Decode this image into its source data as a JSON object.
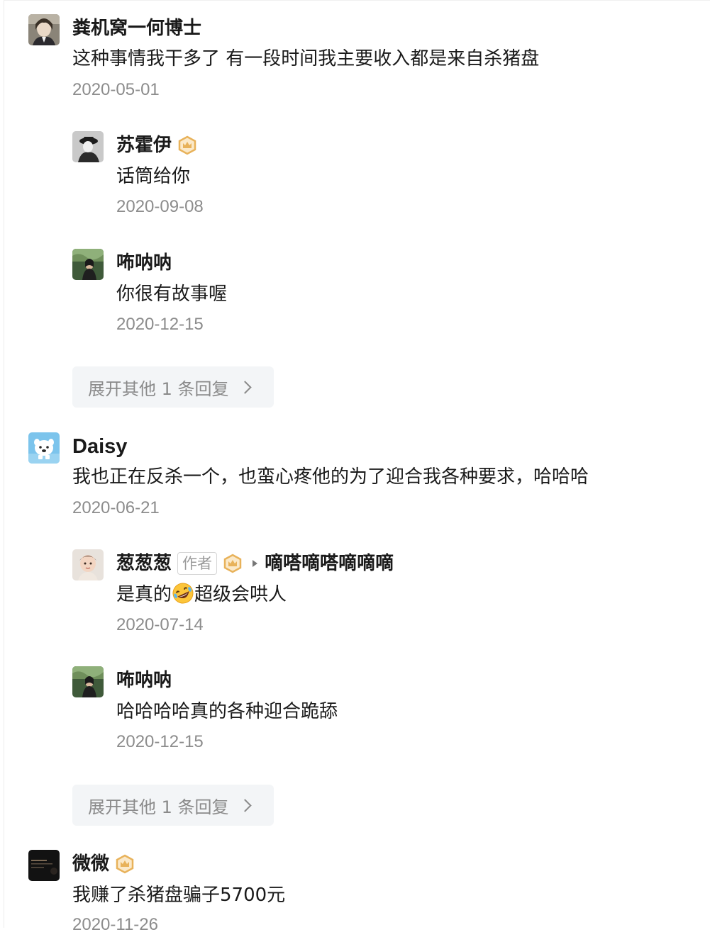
{
  "comments": [
    {
      "user": "粪机窝一何博士",
      "text": "这种事情我干多了 有一段时间我主要收入都是来自杀猪盘",
      "date": "2020-05-01",
      "replies": [
        {
          "user": "苏霍伊",
          "text": "话筒给你",
          "date": "2020-09-08"
        },
        {
          "user": "咘呐呐",
          "text": "你很有故事喔",
          "date": "2020-12-15"
        }
      ],
      "expand_label": "展开其他 1 条回复"
    },
    {
      "user": "Daisy",
      "text": "我也正在反杀一个，也蛮心疼他的为了迎合我各种要求，哈哈哈",
      "date": "2020-06-21",
      "replies": [
        {
          "user": "葱葱葱",
          "author_tag": "作者",
          "reply_to": "嘀嗒嘀嗒嘀嘀嘀",
          "text_before": "是真的",
          "emoji": "rolling-on-floor-laughing-emoji",
          "text_after": "超级会哄人",
          "date": "2020-07-14"
        },
        {
          "user": "咘呐呐",
          "text": "哈哈哈哈真的各种迎合跪舔",
          "date": "2020-12-15"
        }
      ],
      "expand_label": "展开其他 1 条回复"
    },
    {
      "user": "微微",
      "text": "我赚了杀猪盘骗子5700元",
      "date": "2020-11-26"
    }
  ],
  "colors": {
    "text": "#1a1a1a",
    "meta": "#8c8c8c",
    "badge_gold": "#e8b25a",
    "button_bg": "#f3f5f7"
  }
}
